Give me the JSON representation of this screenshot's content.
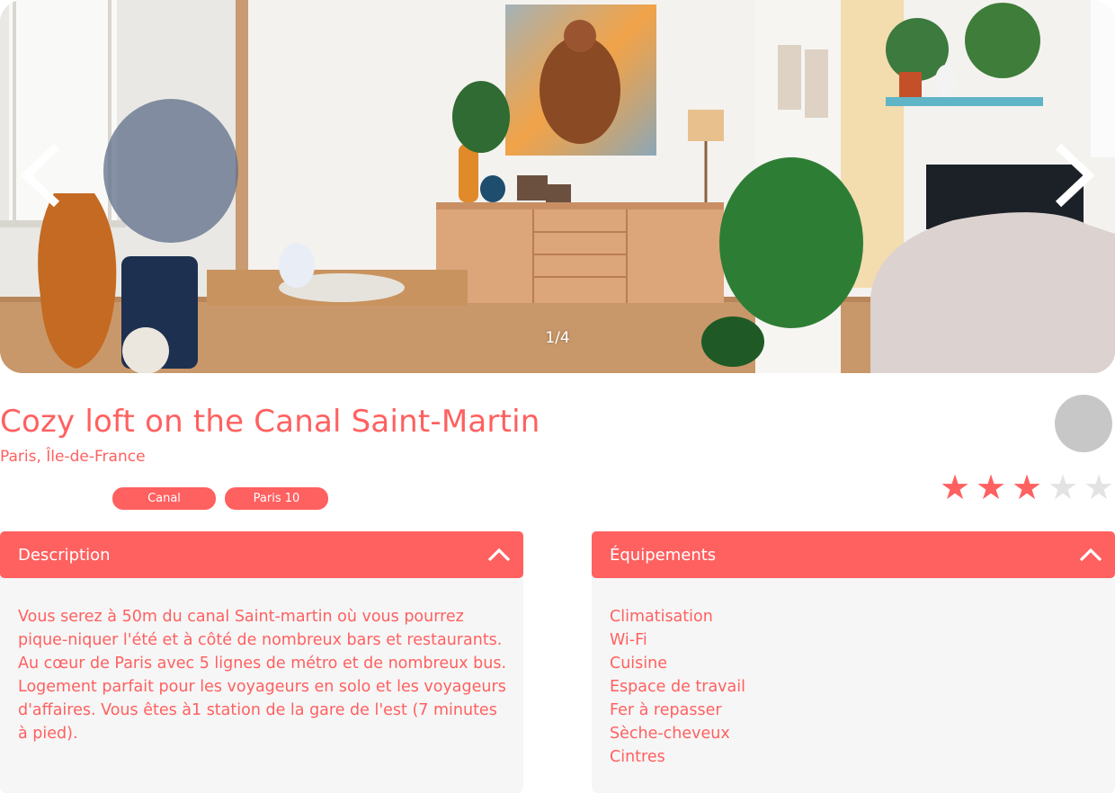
{
  "gallery": {
    "counter": "1/4",
    "prev_icon": "chevron-left-icon",
    "next_icon": "chevron-right-icon"
  },
  "listing": {
    "title": "Cozy loft on the Canal Saint-Martin",
    "location": "Paris, Île-de-France",
    "tags": [
      "Canal",
      "Paris 10"
    ],
    "rating": 3,
    "rating_max": 5
  },
  "description": {
    "header": "Description",
    "text": "Vous serez à 50m du canal Saint-martin où vous pourrez pique-niquer l'été et à côté de nombreux bars et restaurants. Au cœur de Paris avec 5 lignes de métro et de nombreux bus. Logement parfait pour les voyageurs en solo et les voyageurs d'affaires. Vous êtes à1 station de la gare de l'est (7 minutes à pied)."
  },
  "equipments": {
    "header": "Équipements",
    "items": [
      "Climatisation",
      "Wi-Fi",
      "Cuisine",
      "Espace de travail",
      "Fer à repasser",
      "Sèche-cheveux",
      "Cintres"
    ]
  },
  "colors": {
    "accent": "#ff6060",
    "panel_bg": "#f6f6f6",
    "star_empty": "#e3e3e3",
    "avatar_bg": "#c7c7c7"
  }
}
